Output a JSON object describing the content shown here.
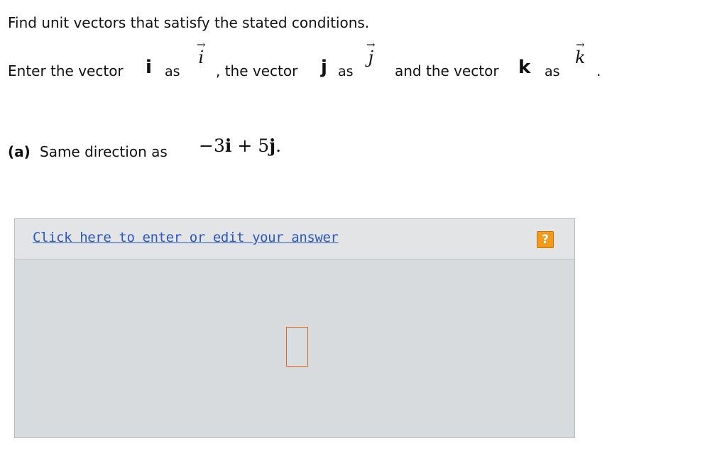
{
  "instruction": "Find unit vectors that satisfy the stated conditions.",
  "enter_line": {
    "p1": "Enter the vector",
    "vec_i": "i",
    "as1": "as",
    "arrow_i": "→",
    "ital_i": "i",
    "p2": ", the vector",
    "vec_j": "j",
    "as2": "as",
    "arrow_j": "→",
    "ital_j": "j",
    "p3": "and the vector",
    "vec_k": "k",
    "as3": "as",
    "arrow_k": "→",
    "ital_k": "k",
    "period": "."
  },
  "part_a": {
    "label": "(a)",
    "text": "Same direction as",
    "expr_minus": "−3",
    "expr_i": "i",
    "expr_plus": "+ 5",
    "expr_j": "j",
    "expr_end": "."
  },
  "answer_panel": {
    "link_text": "Click here to enter or edit your answer",
    "help_label": "?",
    "colors": {
      "link": "#2a56c6",
      "help_bg": "#f29a1b",
      "box_border": "#e0641e"
    }
  }
}
